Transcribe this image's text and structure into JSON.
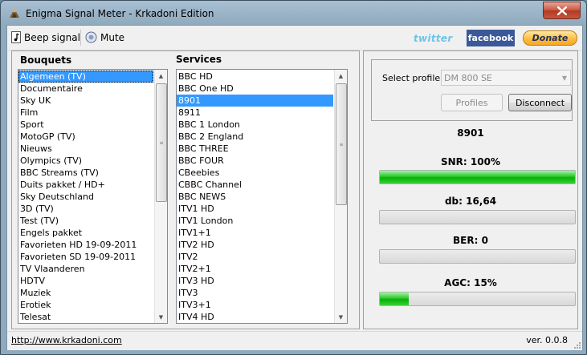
{
  "window": {
    "title": "Enigma Signal Meter - Krkadoni Edition"
  },
  "toolbar": {
    "beep_label": "Beep signal",
    "mute_label": "Mute",
    "twitter_label": "twitter",
    "facebook_label": "facebook",
    "donate_label": "Donate"
  },
  "bouquets": {
    "header": "Bouquets",
    "selected": "Algemeen (TV)",
    "items": [
      "Algemeen (TV)",
      "Documentaire",
      "Sky UK",
      "Film",
      "Sport",
      "MotoGP (TV)",
      "Nieuws",
      "Olympics (TV)",
      "BBC  Streams (TV)",
      "Duits pakket / HD+",
      "Sky Deutschland",
      "3D (TV)",
      "Test (TV)",
      "Engels pakket",
      "Favorieten HD 19-09-2011",
      "Favorieten SD 19-09-2011",
      "TV Vlaanderen",
      "HDTV",
      "Muziek",
      "Erotiek",
      "Telesat"
    ]
  },
  "services": {
    "header": "Services",
    "selected": "8901",
    "items": [
      "BBC HD",
      "BBC One HD",
      "8901",
      "8911",
      "BBC 1 London",
      "BBC 2 England",
      "BBC THREE",
      "BBC FOUR",
      "CBeebies",
      "CBBC Channel",
      "BBC NEWS",
      "ITV1 HD",
      "ITV1 London",
      "ITV1+1",
      "ITV2 HD",
      "ITV2",
      "ITV2+1",
      "ITV3 HD",
      "ITV3",
      "ITV3+1",
      "ITV4 HD"
    ]
  },
  "profile": {
    "label": "Select profile:",
    "value": "DM 800 SE",
    "profiles_button": "Profiles",
    "disconnect_button": "Disconnect"
  },
  "meters": {
    "channel": "8901",
    "snr": {
      "label": "SNR: 100%",
      "percent": 100
    },
    "db": {
      "label": "db: 16,64",
      "percent": 0
    },
    "ber": {
      "label": "BER: 0",
      "percent": 0
    },
    "agc": {
      "label": "AGC: 15%",
      "percent": 15
    }
  },
  "statusbar": {
    "link": "http://www.krkadoni.com",
    "version": "ver. 0.0.8"
  },
  "colors": {
    "selection": "#3399ff",
    "meter_fill": "#22c322",
    "title_bar": "#8fa9bd"
  }
}
